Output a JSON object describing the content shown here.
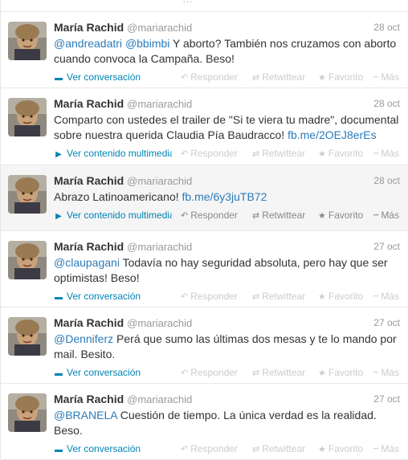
{
  "top_strip": {
    "ghost_text": "···"
  },
  "actions": {
    "reply": "Responder",
    "retweet": "Retwittear",
    "favorite": "Favorito",
    "more": "Más"
  },
  "icons": {
    "reply": "reply-arrow-icon",
    "retweet": "retweet-icon",
    "favorite": "star-icon",
    "more": "dots-icon",
    "conversation": "speech-bubble-icon",
    "media": "play-icon"
  },
  "colors": {
    "link": "#2b7bb9",
    "muted": "#999999",
    "highlight_bg": "#f5f5f5"
  },
  "tweets": [
    {
      "name": "María Rachid",
      "handle": "@mariarachid",
      "date": "28 oct",
      "line1": [
        {
          "t": "@andreadatri",
          "link": true
        },
        {
          "t": " "
        },
        {
          "t": "@bbimbi",
          "link": true
        },
        {
          "t": " Y aborto? También nos cruzamos con aborto"
        }
      ],
      "line2": [
        {
          "t": "cuando convoca la Campaña. Beso!"
        }
      ],
      "expand": "Ver conversación",
      "expand_icon": "conversation"
    },
    {
      "name": "María Rachid",
      "handle": "@mariarachid",
      "date": "28 oct",
      "line1": [
        {
          "t": "Comparto con ustedes el trailer de \"Si te viera tu madre\", documental"
        }
      ],
      "line2": [
        {
          "t": "sobre nuestra querida Claudia Pía Baudracco! "
        },
        {
          "t": "fb.me/2OEJ8erEs",
          "link": true
        }
      ],
      "expand": "Ver contenido multimedia",
      "expand_icon": "media"
    },
    {
      "name": "María Rachid",
      "handle": "@mariarachid",
      "date": "28 oct",
      "highlight": true,
      "line1": [
        {
          "t": "Abrazo Latinoamericano! "
        },
        {
          "t": "fb.me/6y3juTB72",
          "link": true
        }
      ],
      "line2": [],
      "expand": "Ver contenido multimedia",
      "expand_icon": "media"
    },
    {
      "name": "María Rachid",
      "handle": "@mariarachid",
      "date": "27 oct",
      "line1": [
        {
          "t": "@claupagani",
          "link": true
        },
        {
          "t": " Todavía no hay seguridad absoluta, pero hay que ser"
        }
      ],
      "line2": [
        {
          "t": "optimistas! Beso!"
        }
      ],
      "expand": "Ver conversación",
      "expand_icon": "conversation"
    },
    {
      "name": "María Rachid",
      "handle": "@mariarachid",
      "date": "27 oct",
      "line1": [
        {
          "t": "@Denniferz",
          "link": true
        },
        {
          "t": " Perá que sumo las últimas dos mesas y te lo mando por"
        }
      ],
      "line2": [
        {
          "t": "mail. Besito."
        }
      ],
      "expand": "Ver conversación",
      "expand_icon": "conversation"
    },
    {
      "name": "María Rachid",
      "handle": "@mariarachid",
      "date": "27 oct",
      "line1": [
        {
          "t": "@BRANELA",
          "link": true
        },
        {
          "t": " Cuestión de tiempo. La única verdad es la realidad."
        }
      ],
      "line2": [
        {
          "t": "Beso."
        }
      ],
      "expand": "Ver conversación",
      "expand_icon": "conversation"
    }
  ]
}
